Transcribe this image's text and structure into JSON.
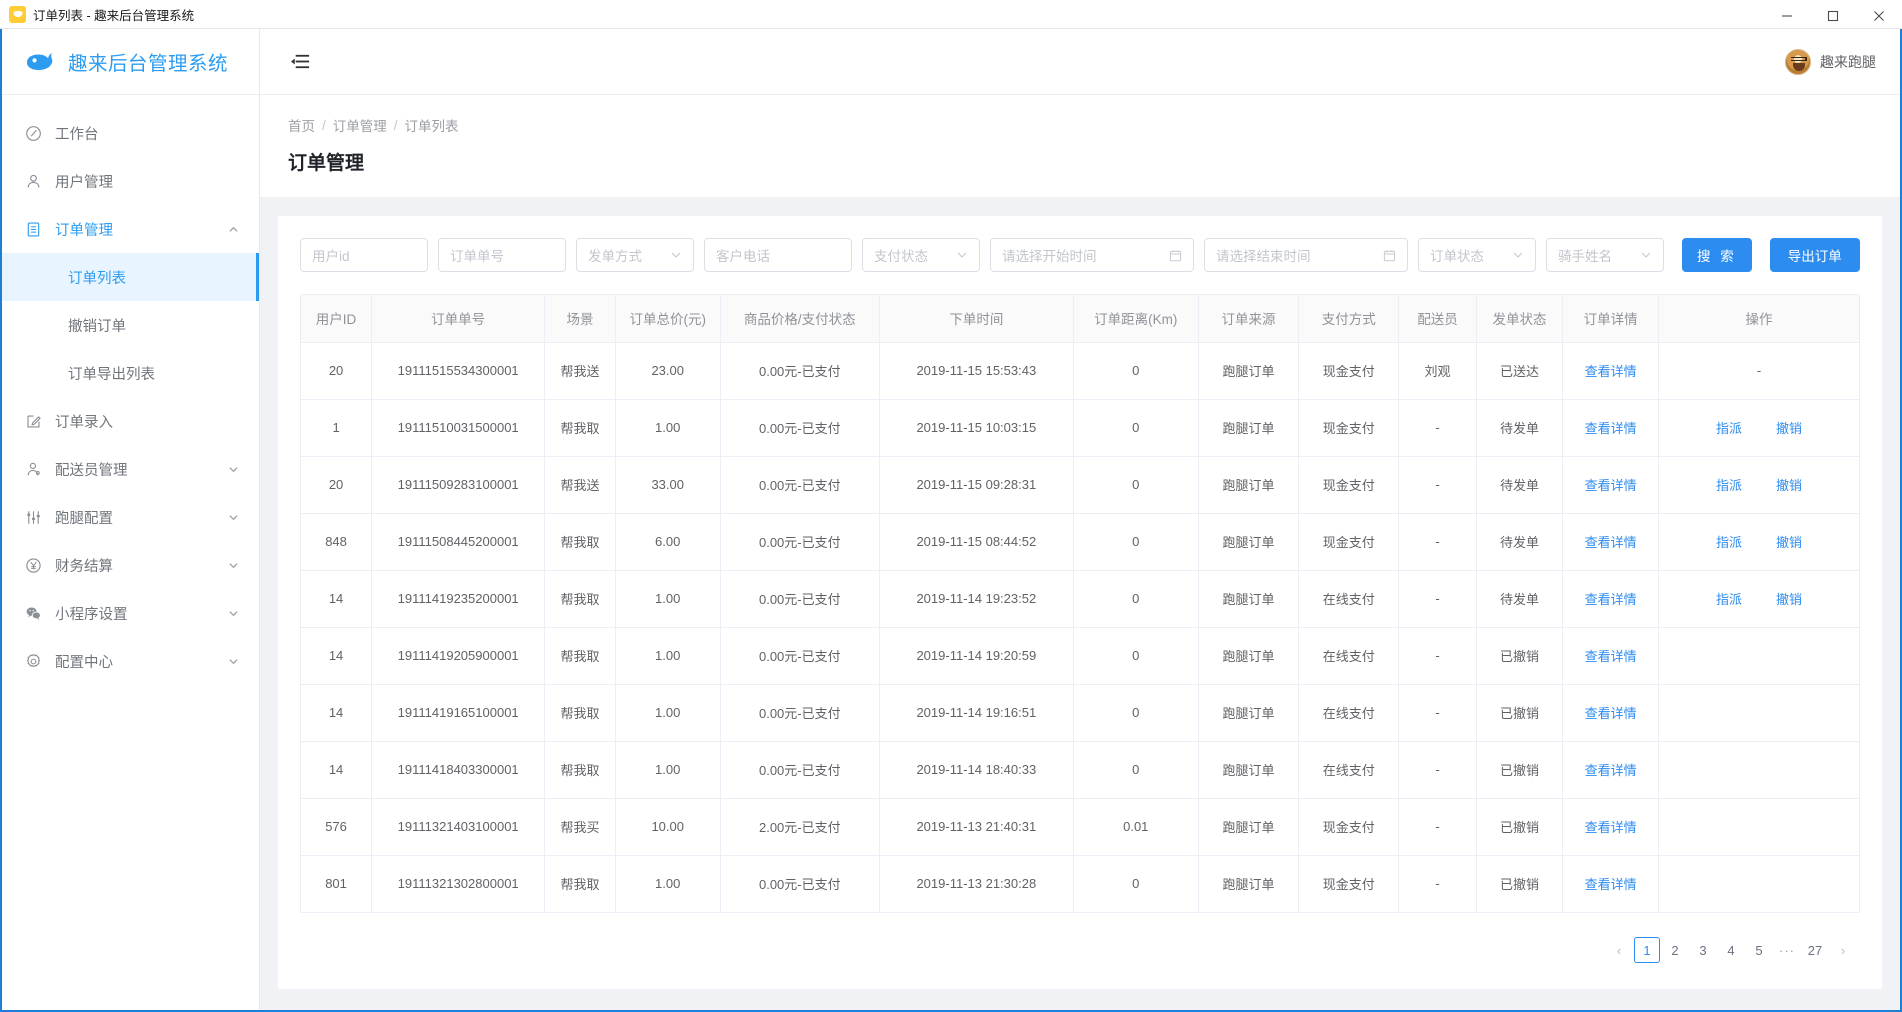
{
  "window": {
    "title": "订单列表 - 趣来后台管理系统",
    "app_icon": "app-logo-icon",
    "minimize": "—",
    "maximize": "□",
    "close": "✕"
  },
  "sidebar": {
    "brand": "趣来后台管理系统",
    "brand_logo": "whale-logo-icon",
    "items": [
      {
        "label": "工作台",
        "icon": "dashboard-icon",
        "expandable": false,
        "active": false
      },
      {
        "label": "用户管理",
        "icon": "user-icon",
        "expandable": false,
        "active": false
      },
      {
        "label": "订单管理",
        "icon": "document-icon",
        "expandable": true,
        "expanded": true,
        "active": true,
        "children": [
          {
            "label": "订单列表",
            "selected": true
          },
          {
            "label": "撤销订单",
            "selected": false
          },
          {
            "label": "订单导出列表",
            "selected": false
          }
        ]
      },
      {
        "label": "订单录入",
        "icon": "edit-icon",
        "expandable": false,
        "active": false
      },
      {
        "label": "配送员管理",
        "icon": "courier-icon",
        "expandable": true,
        "expanded": false,
        "active": false
      },
      {
        "label": "跑腿配置",
        "icon": "sliders-icon",
        "expandable": true,
        "expanded": false,
        "active": false
      },
      {
        "label": "财务结算",
        "icon": "money-icon",
        "expandable": true,
        "expanded": false,
        "active": false
      },
      {
        "label": "小程序设置",
        "icon": "wechat-icon",
        "expandable": true,
        "expanded": false,
        "active": false
      },
      {
        "label": "配置中心",
        "icon": "gear-icon",
        "expandable": true,
        "expanded": false,
        "active": false
      }
    ]
  },
  "topbar": {
    "collapse_icon": "menu-fold-icon",
    "user_name": "趣来跑腿",
    "avatar": "dog-avatar"
  },
  "breadcrumb": {
    "items": [
      "首页",
      "订单管理",
      "订单列表"
    ],
    "separator": "/"
  },
  "page": {
    "title": "订单管理"
  },
  "filters": {
    "user_id": {
      "placeholder": "用户id",
      "value": ""
    },
    "order_no": {
      "placeholder": "订单单号",
      "value": ""
    },
    "send_way": {
      "placeholder": "发单方式",
      "value": "",
      "icon": "chevron-down-icon"
    },
    "customer_phone": {
      "placeholder": "客户电话",
      "value": ""
    },
    "pay_status": {
      "placeholder": "支付状态",
      "value": "",
      "icon": "chevron-down-icon"
    },
    "start_time": {
      "placeholder": "请选择开始时间",
      "value": "",
      "icon": "calendar-icon"
    },
    "end_time": {
      "placeholder": "请选择结束时间",
      "value": "",
      "icon": "calendar-icon"
    },
    "order_status": {
      "placeholder": "订单状态",
      "value": "",
      "icon": "chevron-down-icon"
    },
    "rider_name": {
      "placeholder": "骑手姓名",
      "value": "",
      "icon": "chevron-down-icon"
    },
    "search_button": "搜 索",
    "export_button": "导出订单"
  },
  "table": {
    "columns": [
      "用户ID",
      "订单单号",
      "场景",
      "订单总价(元)",
      "商品价格/支付状态",
      "下单时间",
      "订单距离(Km)",
      "订单来源",
      "支付方式",
      "配送员",
      "发单状态",
      "订单详情",
      "操作"
    ],
    "detail_link": "查看详情",
    "action_assign": "指派",
    "action_cancel": "撤销",
    "empty": "-",
    "rows": [
      {
        "user_id": "20",
        "order_no": "19111515534300001",
        "scene": "帮我送",
        "total": "23.00",
        "goods_price": "0.00元-已支付",
        "order_time": "2019-11-15 15:53:43",
        "distance": "0",
        "source": "跑腿订单",
        "pay_method": "现金支付",
        "courier": "刘观",
        "status": "已送达",
        "detail": "查看详情",
        "actions": []
      },
      {
        "user_id": "1",
        "order_no": "19111510031500001",
        "scene": "帮我取",
        "total": "1.00",
        "goods_price": "0.00元-已支付",
        "order_time": "2019-11-15 10:03:15",
        "distance": "0",
        "source": "跑腿订单",
        "pay_method": "现金支付",
        "courier": "-",
        "status": "待发单",
        "detail": "查看详情",
        "actions": [
          "指派",
          "撤销"
        ]
      },
      {
        "user_id": "20",
        "order_no": "19111509283100001",
        "scene": "帮我送",
        "total": "33.00",
        "goods_price": "0.00元-已支付",
        "order_time": "2019-11-15 09:28:31",
        "distance": "0",
        "source": "跑腿订单",
        "pay_method": "现金支付",
        "courier": "-",
        "status": "待发单",
        "detail": "查看详情",
        "actions": [
          "指派",
          "撤销"
        ]
      },
      {
        "user_id": "848",
        "order_no": "19111508445200001",
        "scene": "帮我取",
        "total": "6.00",
        "goods_price": "0.00元-已支付",
        "order_time": "2019-11-15 08:44:52",
        "distance": "0",
        "source": "跑腿订单",
        "pay_method": "现金支付",
        "courier": "-",
        "status": "待发单",
        "detail": "查看详情",
        "actions": [
          "指派",
          "撤销"
        ]
      },
      {
        "user_id": "14",
        "order_no": "19111419235200001",
        "scene": "帮我取",
        "total": "1.00",
        "goods_price": "0.00元-已支付",
        "order_time": "2019-11-14 19:23:52",
        "distance": "0",
        "source": "跑腿订单",
        "pay_method": "在线支付",
        "courier": "-",
        "status": "待发单",
        "detail": "查看详情",
        "actions": [
          "指派",
          "撤销"
        ]
      },
      {
        "user_id": "14",
        "order_no": "19111419205900001",
        "scene": "帮我取",
        "total": "1.00",
        "goods_price": "0.00元-已支付",
        "order_time": "2019-11-14 19:20:59",
        "distance": "0",
        "source": "跑腿订单",
        "pay_method": "在线支付",
        "courier": "-",
        "status": "已撤销",
        "detail": "查看详情",
        "actions": []
      },
      {
        "user_id": "14",
        "order_no": "19111419165100001",
        "scene": "帮我取",
        "total": "1.00",
        "goods_price": "0.00元-已支付",
        "order_time": "2019-11-14 19:16:51",
        "distance": "0",
        "source": "跑腿订单",
        "pay_method": "在线支付",
        "courier": "-",
        "status": "已撤销",
        "detail": "查看详情",
        "actions": []
      },
      {
        "user_id": "14",
        "order_no": "19111418403300001",
        "scene": "帮我取",
        "total": "1.00",
        "goods_price": "0.00元-已支付",
        "order_time": "2019-11-14 18:40:33",
        "distance": "0",
        "source": "跑腿订单",
        "pay_method": "在线支付",
        "courier": "-",
        "status": "已撤销",
        "detail": "查看详情",
        "actions": []
      },
      {
        "user_id": "576",
        "order_no": "19111321403100001",
        "scene": "帮我买",
        "total": "10.00",
        "goods_price": "2.00元-已支付",
        "order_time": "2019-11-13 21:40:31",
        "distance": "0.01",
        "source": "跑腿订单",
        "pay_method": "现金支付",
        "courier": "-",
        "status": "已撤销",
        "detail": "查看详情",
        "actions": []
      },
      {
        "user_id": "801",
        "order_no": "19111321302800001",
        "scene": "帮我取",
        "total": "1.00",
        "goods_price": "0.00元-已支付",
        "order_time": "2019-11-13 21:30:28",
        "distance": "0",
        "source": "跑腿订单",
        "pay_method": "现金支付",
        "courier": "-",
        "status": "已撤销",
        "detail": "查看详情",
        "actions": []
      }
    ]
  },
  "pagination": {
    "prev": "‹",
    "next": "›",
    "pages": [
      "1",
      "2",
      "3",
      "4",
      "5"
    ],
    "ellipsis": "···",
    "last_page": "27",
    "current": "1"
  },
  "colors": {
    "accent": "#2d8cf0",
    "brand": "#2d9cf0",
    "title_bar_border": "#1f7fd4",
    "selected_bg": "#e8f4ff",
    "page_bg": "#f0f2f5",
    "border": "#ebeef5",
    "text_primary": "#1f2329",
    "text_secondary": "#606266",
    "text_muted": "#909399",
    "placeholder": "#c2c6cc"
  }
}
